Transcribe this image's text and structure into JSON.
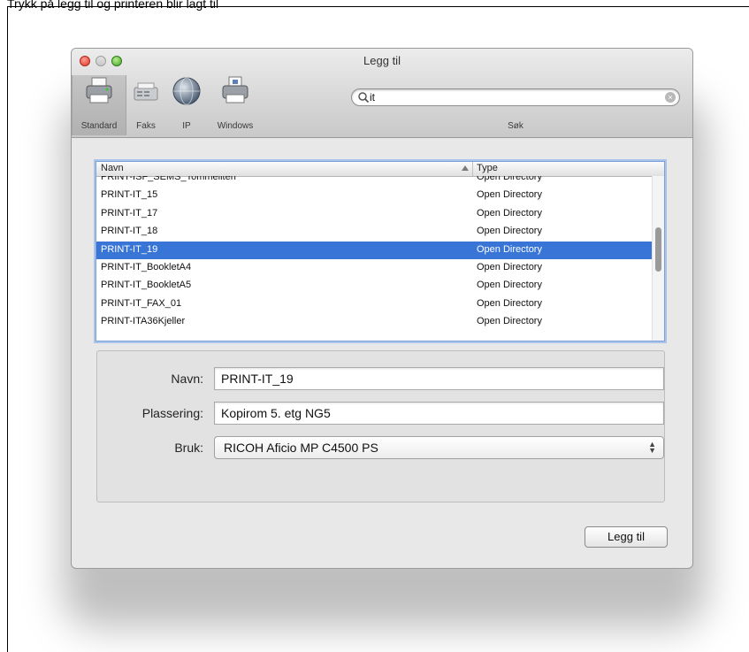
{
  "caption": "Trykk på legg til og printeren blir lagt til",
  "window": {
    "title": "Legg til"
  },
  "toolbar": {
    "buttons": [
      {
        "label": "Standard",
        "icon": "printer-icon"
      },
      {
        "label": "Faks",
        "icon": "fax-icon"
      },
      {
        "label": "IP",
        "icon": "globe-icon"
      },
      {
        "label": "Windows",
        "icon": "windows-printer-icon"
      }
    ],
    "search": {
      "value": "it",
      "label": "Søk"
    }
  },
  "list": {
    "columns": {
      "name": "Navn",
      "type": "Type"
    },
    "rows": [
      {
        "name": "PRINT-ISF_SEMS_Tommeliten",
        "type": "Open Directory"
      },
      {
        "name": "PRINT-IT_15",
        "type": "Open Directory"
      },
      {
        "name": "PRINT-IT_17",
        "type": "Open Directory"
      },
      {
        "name": "PRINT-IT_18",
        "type": "Open Directory"
      },
      {
        "name": "PRINT-IT_19",
        "type": "Open Directory",
        "selected": true
      },
      {
        "name": "PRINT-IT_BookletA4",
        "type": "Open Directory"
      },
      {
        "name": "PRINT-IT_BookletA5",
        "type": "Open Directory"
      },
      {
        "name": "PRINT-IT_FAX_01",
        "type": "Open Directory"
      },
      {
        "name": "PRINT-ITA36Kjeller",
        "type": "Open Directory"
      }
    ]
  },
  "details": {
    "name_label": "Navn:",
    "name_value": "PRINT-IT_19",
    "location_label": "Plassering:",
    "location_value": "Kopirom 5. etg NG5",
    "use_label": "Bruk:",
    "use_value": "RICOH Aficio MP C4500 PS"
  },
  "actions": {
    "add_label": "Legg til"
  },
  "colors": {
    "selection": "#3875d7",
    "focus_ring": "#a9c3ea"
  }
}
